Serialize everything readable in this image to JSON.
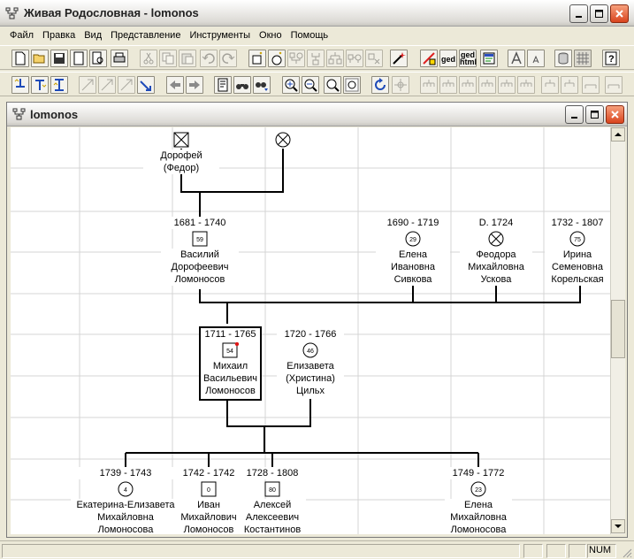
{
  "app": {
    "title": "Живая Родословная - lomonos"
  },
  "menu": [
    "Файл",
    "Правка",
    "Вид",
    "Представление",
    "Инструменты",
    "Окно",
    "Помощь"
  ],
  "toolbar": {
    "ged_label": "ged",
    "ged_html_label_1": "ged",
    "ged_html_label_2": "html"
  },
  "child_window": {
    "title": "lomonos"
  },
  "tree": {
    "people": [
      {
        "id": "dorofey",
        "dates": "",
        "lines": [
          "Дорофей",
          "(Федор)"
        ],
        "sex": "male",
        "age": "",
        "deceased": true
      },
      {
        "id": "dorofey-wife",
        "dates": "",
        "lines": [],
        "sex": "female",
        "age": "",
        "deceased": true
      },
      {
        "id": "vasiliy",
        "dates": "1681 - 1740",
        "lines": [
          "Василий",
          "Дорофеевич",
          "Ломоносов"
        ],
        "sex": "male",
        "age": "59",
        "deceased": false
      },
      {
        "id": "elena-sivkova",
        "dates": "1690 - 1719",
        "lines": [
          "Елена",
          "Ивановна",
          "Сивкова"
        ],
        "sex": "female",
        "age": "29",
        "deceased": false
      },
      {
        "id": "feodora",
        "dates": "D. 1724",
        "lines": [
          "Феодора",
          "Михайловна",
          "Ускова"
        ],
        "sex": "female",
        "age": "",
        "deceased": true
      },
      {
        "id": "irina",
        "dates": "1732 - 1807",
        "lines": [
          "Ирина",
          "Семеновна",
          "Корельская"
        ],
        "sex": "female",
        "age": "75",
        "deceased": false
      },
      {
        "id": "mikhail",
        "dates": "1711 - 1765",
        "lines": [
          "Михаил",
          "Васильевич",
          "Ломоносов"
        ],
        "sex": "male",
        "age": "54",
        "deceased": false
      },
      {
        "id": "elizaveta",
        "dates": "1720 - 1766",
        "lines": [
          "Елизавета",
          "(Христина)",
          "Цильх"
        ],
        "sex": "female",
        "age": "46",
        "deceased": false
      },
      {
        "id": "ekaterina",
        "dates": "1739 - 1743",
        "lines": [
          "Екатерина-Елизавета",
          "Михайловна",
          "Ломоносова"
        ],
        "sex": "female",
        "age": "4",
        "deceased": false
      },
      {
        "id": "ivan",
        "dates": "1742 - 1742",
        "lines": [
          "Иван",
          "Михайлович",
          "Ломоносов"
        ],
        "sex": "male",
        "age": "0",
        "deceased": false
      },
      {
        "id": "aleksey",
        "dates": "1728 - 1808",
        "lines": [
          "Алексей",
          "Алексеевич",
          "Костантинов"
        ],
        "sex": "male",
        "age": "80",
        "deceased": false
      },
      {
        "id": "elena-lomonosova",
        "dates": "1749 - 1772",
        "lines": [
          "Елена",
          "Михайловна",
          "Ломоносова"
        ],
        "sex": "female",
        "age": "23",
        "deceased": false
      }
    ]
  },
  "status": {
    "num": "NUM"
  }
}
